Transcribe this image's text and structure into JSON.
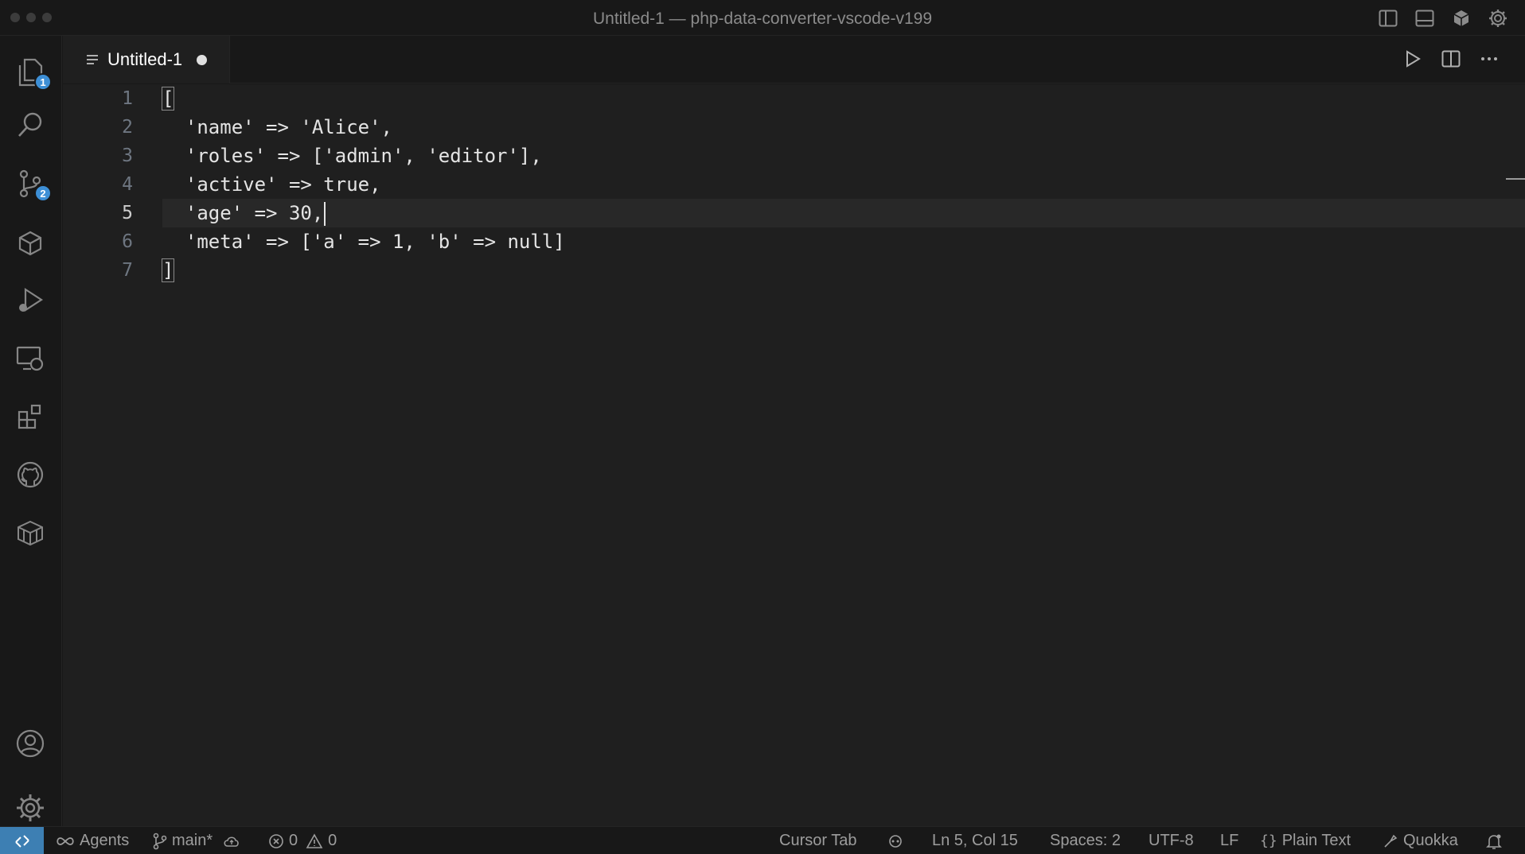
{
  "window": {
    "title": "Untitled-1 — php-data-converter-vscode-v199"
  },
  "activity_bar": {
    "explorer_badge": "1",
    "source_control_badge": "2"
  },
  "tab": {
    "label": "Untitled-1"
  },
  "editor": {
    "line_numbers": [
      "1",
      "2",
      "3",
      "4",
      "5",
      "6",
      "7"
    ],
    "active_line": 5,
    "lines": [
      "[",
      "  'name' => 'Alice',",
      "  'roles' => ['admin', 'editor'],",
      "  'active' => true,",
      "  'age' => 30,",
      "  'meta' => ['a' => 1, 'b' => null]",
      "]"
    ]
  },
  "status_bar": {
    "agents": "Agents",
    "branch": "main*",
    "errors": "0",
    "warnings": "0",
    "cursor_tab": "Cursor Tab",
    "position": "Ln 5, Col 15",
    "spaces": "Spaces: 2",
    "encoding": "UTF-8",
    "eol": "LF",
    "language": "Plain Text",
    "quokka": "Quokka"
  },
  "colors": {
    "accent": "#3d8fd6",
    "remote_indicator": "#3d7fb3",
    "editor_bg": "#1f1f1f",
    "chrome_bg": "#181818"
  },
  "icons": {
    "activity": [
      "files-icon",
      "search-icon",
      "source-control-icon",
      "cube-icon",
      "run-debug-icon",
      "remote-explorer-icon",
      "extensions-icon",
      "github-icon",
      "package-icon",
      "account-icon",
      "settings-gear-icon"
    ],
    "title_actions": [
      "toggle-sidebar-icon",
      "toggle-panel-icon",
      "cube-icon",
      "settings-gear-icon"
    ],
    "editor_actions": [
      "run-icon",
      "split-editor-icon",
      "more-actions-icon"
    ]
  }
}
